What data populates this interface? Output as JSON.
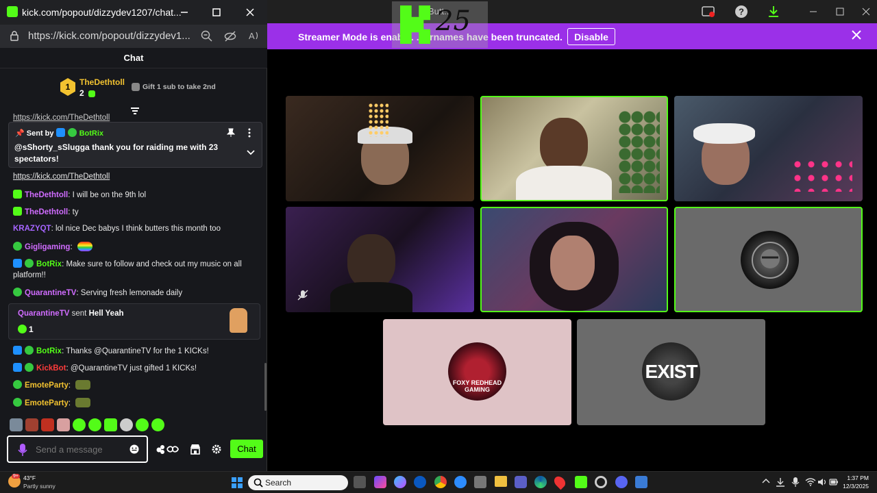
{
  "popout": {
    "title": "kick.com/popout/dizzydev1207/chat...",
    "url": "https://kick.com/popout/dizzydev1...",
    "chat_header": "Chat"
  },
  "leaderboard": {
    "rank": "1",
    "user": "TheDethtoll",
    "count": "2",
    "gift_prompt": "Gift 1 sub to take 2nd"
  },
  "pinned": {
    "partial_link": "https://kick.com/TheDethtoll",
    "sent_by_label": "Sent by",
    "sender": "BotRix",
    "text_line1": "@sShorty_sSlugga thank you for raiding me with 23",
    "text_line2": "spectators!"
  },
  "messages": [
    {
      "link": "https://kick.com/TheDethtoll"
    },
    {
      "user": "TheDethtoll",
      "text": ": I will be on the 9th lol"
    },
    {
      "user": "TheDethtoll",
      "text": ": ty"
    },
    {
      "user": "KRAZYQT",
      "text": ": lol nice Dec babys I think butters this month too"
    },
    {
      "user": "Gigligaming",
      "text": ":"
    },
    {
      "user": "BotRix",
      "text": ": Make sure to follow and check out my music on all",
      "text2": "platform!!"
    },
    {
      "user": "QuarantineTV",
      "text": ": Serving fresh lemonade daily"
    },
    {
      "user": "BotRix",
      "text": ": Thanks @QuarantineTV for the 1 KICKs!"
    },
    {
      "user": "KickBot",
      "text": ": @QuarantineTV just gifted 1 KICKs!"
    },
    {
      "user": "EmoteParty",
      "text": ":"
    },
    {
      "user": "EmoteParty",
      "text": ":"
    }
  ],
  "gift_card": {
    "user": "QuarantineTV",
    "sent_label": "sent",
    "item": "Hell Yeah",
    "amount": "1"
  },
  "input": {
    "placeholder": "Send a message",
    "chat_button": "Chat"
  },
  "main": {
    "title": "Butt...",
    "streamer_bar_text": "Streamer Mode is enabl... ...ernames have been truncated.",
    "disable_label": "Disable",
    "logo_number": "25",
    "tiles": [
      {
        "name": "cam-1"
      },
      {
        "name": "cam-2"
      },
      {
        "name": "cam-3"
      },
      {
        "name": "cam-4"
      },
      {
        "name": "cam-5"
      },
      {
        "name": "avatar-6"
      },
      {
        "name": "avatar-foxy",
        "line1": "FOXY REDHEAD",
        "line2": "GAMING"
      },
      {
        "name": "avatar-exist",
        "label": "EXIST"
      }
    ]
  },
  "taskbar": {
    "weather_temp": "43°F",
    "weather_desc": "Partly sunny",
    "search_label": "Search",
    "time": "1:37 PM",
    "date": "12/3/2025",
    "notification_badge": "9+"
  },
  "colors": {
    "kick_green": "#53fc18",
    "streamer_purple": "#9b30e8"
  }
}
